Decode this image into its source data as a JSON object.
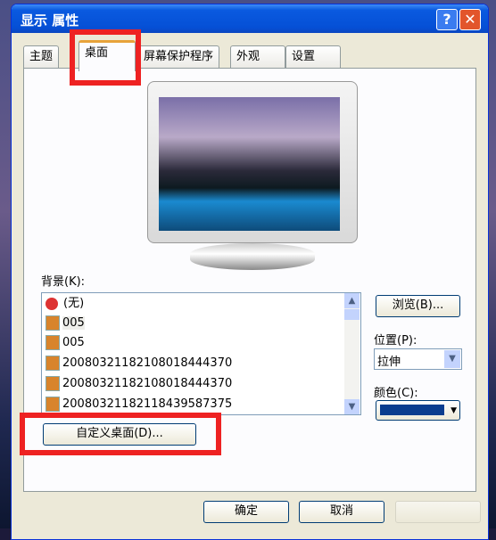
{
  "window": {
    "title": "显示 属性",
    "help": "?",
    "close": "✕"
  },
  "tabs": [
    "主题",
    "桌面",
    "屏幕保护程序",
    "外观",
    "设置"
  ],
  "background": {
    "label": "背景(K):",
    "items": [
      "(无)",
      "005",
      "005",
      "20080321182108018444370",
      "20080321182108018444370",
      "20080321182118439587375"
    ]
  },
  "browse": "浏览(B)...",
  "position": {
    "label": "位置(P):",
    "value": "拉伸"
  },
  "color": {
    "label": "颜色(C):",
    "value": "#0a3d8f"
  },
  "customize": "自定义桌面(D)...",
  "ok": "确定",
  "cancel": "取消"
}
